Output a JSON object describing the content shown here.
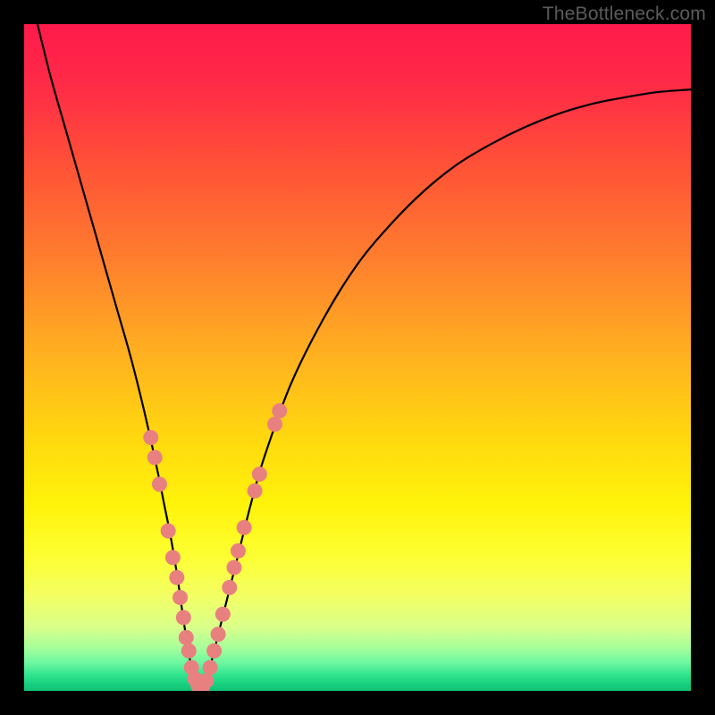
{
  "watermark": "TheBottleneck.com",
  "colors": {
    "gradient_stops": [
      {
        "offset": 0.0,
        "color": "#ff1a4b"
      },
      {
        "offset": 0.1,
        "color": "#ff2d46"
      },
      {
        "offset": 0.22,
        "color": "#ff5436"
      },
      {
        "offset": 0.35,
        "color": "#ff7d2e"
      },
      {
        "offset": 0.5,
        "color": "#ffb21f"
      },
      {
        "offset": 0.62,
        "color": "#ffd80f"
      },
      {
        "offset": 0.72,
        "color": "#fff30a"
      },
      {
        "offset": 0.8,
        "color": "#fdff33"
      },
      {
        "offset": 0.86,
        "color": "#f2ff66"
      },
      {
        "offset": 0.905,
        "color": "#d9ff8a"
      },
      {
        "offset": 0.935,
        "color": "#a7ff9a"
      },
      {
        "offset": 0.958,
        "color": "#6cf7a0"
      },
      {
        "offset": 0.975,
        "color": "#34e58f"
      },
      {
        "offset": 0.99,
        "color": "#17d07e"
      },
      {
        "offset": 1.0,
        "color": "#12c275"
      }
    ],
    "curve": "#000000",
    "dot_fill": "#e98080",
    "dot_stroke": "#c96a6a"
  },
  "chart_data": {
    "type": "line",
    "title": "",
    "xlabel": "",
    "ylabel": "",
    "xlim": [
      0,
      100
    ],
    "ylim": [
      0,
      100
    ],
    "grid": false,
    "series": [
      {
        "name": "bottleneck-curve",
        "x": [
          2,
          4,
          6,
          8,
          10,
          12,
          14,
          16,
          18,
          20,
          21,
          22,
          23,
          24,
          25,
          26,
          27,
          28,
          30,
          32,
          34,
          36,
          40,
          45,
          50,
          55,
          60,
          65,
          70,
          75,
          80,
          85,
          90,
          95,
          100
        ],
        "y": [
          100,
          92,
          85,
          78,
          71,
          64,
          57,
          50,
          42,
          33,
          28,
          23,
          17,
          10,
          4,
          0,
          0,
          4,
          12,
          20,
          28,
          35,
          46,
          56,
          64,
          70,
          75,
          79,
          82,
          84.5,
          86.5,
          88,
          89,
          89.8,
          90.2
        ]
      }
    ],
    "highlight_points": {
      "name": "sample-dots",
      "points": [
        {
          "x": 19.0,
          "y": 38
        },
        {
          "x": 19.6,
          "y": 35
        },
        {
          "x": 20.3,
          "y": 31
        },
        {
          "x": 21.6,
          "y": 24
        },
        {
          "x": 22.3,
          "y": 20
        },
        {
          "x": 22.9,
          "y": 17
        },
        {
          "x": 23.4,
          "y": 14
        },
        {
          "x": 23.9,
          "y": 11
        },
        {
          "x": 24.3,
          "y": 8
        },
        {
          "x": 24.7,
          "y": 6
        },
        {
          "x": 25.1,
          "y": 3.5
        },
        {
          "x": 25.6,
          "y": 1.8
        },
        {
          "x": 26.1,
          "y": 0.8
        },
        {
          "x": 26.7,
          "y": 0.5
        },
        {
          "x": 27.3,
          "y": 1.5
        },
        {
          "x": 27.9,
          "y": 3.5
        },
        {
          "x": 28.5,
          "y": 6
        },
        {
          "x": 29.1,
          "y": 8.5
        },
        {
          "x": 29.8,
          "y": 11.5
        },
        {
          "x": 30.8,
          "y": 15.5
        },
        {
          "x": 31.5,
          "y": 18.5
        },
        {
          "x": 32.1,
          "y": 21
        },
        {
          "x": 33.0,
          "y": 24.5
        },
        {
          "x": 34.6,
          "y": 30
        },
        {
          "x": 35.3,
          "y": 32.5
        },
        {
          "x": 37.6,
          "y": 40
        },
        {
          "x": 38.3,
          "y": 42
        }
      ]
    }
  }
}
